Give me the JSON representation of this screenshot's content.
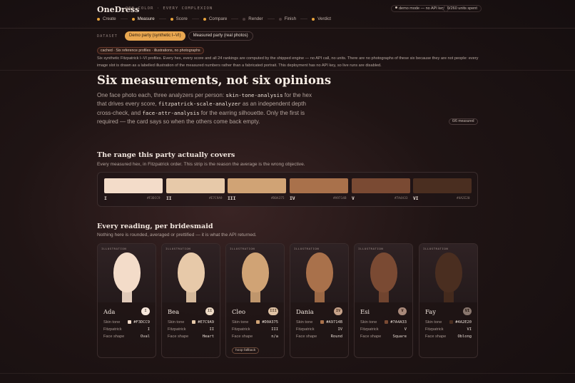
{
  "header": {
    "brand": "OneDress",
    "brand_sub": "ONE COLOR · EVERY COMPLEXION",
    "demo_pill": "demo mode — no API key",
    "units_pill": "0/260 units spent",
    "steps": [
      {
        "label": "Create",
        "color": "#e8a33c"
      },
      {
        "label": "Measure",
        "color": "#e8a33c"
      },
      {
        "label": "Score",
        "color": "#e8a33c"
      },
      {
        "label": "Compare",
        "color": "#e8a33c"
      },
      {
        "label": "Render",
        "color": "#4a3a3a"
      },
      {
        "label": "Finish",
        "color": "#4a3a3a"
      },
      {
        "label": "Verdict",
        "color": "#e8a33c"
      }
    ]
  },
  "dataset": {
    "label": "DATASET",
    "options": [
      "Demo party (synthetic I–VI)",
      "Measured party (real photos)"
    ],
    "selected": "Demo party (synthetic I–VI)"
  },
  "notice": {
    "chip": "cached · Six reference profiles · illustrations, no photographs",
    "text": "Six synthetic Fitzpatrick I–VI profiles. Every hex, every score and all 24 rankings are computed by the shipped engine — no API call, no units. There are no photographs of these six because they are not people: every image slot is drawn as a labelled illustration of the measured numbers rather than a fabricated portrait. This deployment has no API key, so live runs are disabled."
  },
  "hero": {
    "title": "Six measurements, not six opinions",
    "p1": "One face photo each, three analyzers per person: ",
    "c1": "skin-tone-analysis",
    "p2": " for the hex that drives every score, ",
    "c2": "fitzpatrick-scale-analyzer",
    "p3": " as an independent depth cross-check, and ",
    "c3": "face-attr-analysis",
    "p4": " for the earring silhouette. Only the first is required — the card says so when the others come back empty.",
    "badge": "6/6 measured"
  },
  "range": {
    "title": "The range this party actually covers",
    "subtitle": "Every measured hex, in Fitzpatrick order. This strip is the reason the average is the wrong objective.",
    "swatches": [
      {
        "roman": "I",
        "hex": "#F3DCC9",
        "color": "#f3dcc9"
      },
      {
        "roman": "II",
        "hex": "#E7C9A9",
        "color": "#e7c9a9"
      },
      {
        "roman": "III",
        "hex": "#D0A375",
        "color": "#d0a375"
      },
      {
        "roman": "IV",
        "hex": "#A9714B",
        "color": "#a9714b"
      },
      {
        "roman": "V",
        "hex": "#7A4A33",
        "color": "#7a4a33"
      },
      {
        "roman": "VI",
        "hex": "#4A2E20",
        "color": "#4a2e20"
      }
    ]
  },
  "readings": {
    "title": "Every reading, per bridesmaid",
    "subtitle": "Nothing here is rounded, averaged or prettified — it is what the API returned.",
    "illu_tag": "ILLUSTRATION",
    "lbl_skin": "Skin tone",
    "lbl_fitz": "Fitzpatrick",
    "lbl_face": "Face shape",
    "fallback_label": "hoop fallback",
    "people": [
      {
        "name": "Ada",
        "roman": "I",
        "hex": "#F3DCC9",
        "color": "#f3dcc9",
        "fitz": "I",
        "face": "Oval"
      },
      {
        "name": "Bea",
        "roman": "II",
        "hex": "#E7C9A9",
        "color": "#e7c9a9",
        "fitz": "II",
        "face": "Heart"
      },
      {
        "name": "Cleo",
        "roman": "III",
        "hex": "#D0A375",
        "color": "#d0a375",
        "fitz": "III",
        "face": "n/a"
      },
      {
        "name": "Dania",
        "roman": "IV",
        "hex": "#A9714B",
        "color": "#a9714b",
        "fitz": "IV",
        "face": "Round"
      },
      {
        "name": "Esi",
        "roman": "V",
        "hex": "#7A4A33",
        "color": "#7a4a33",
        "fitz": "V",
        "face": "Square"
      },
      {
        "name": "Fay",
        "roman": "VI",
        "hex": "#4A2E20",
        "color": "#4a2e20",
        "fitz": "VI",
        "face": "Oblong"
      }
    ]
  }
}
